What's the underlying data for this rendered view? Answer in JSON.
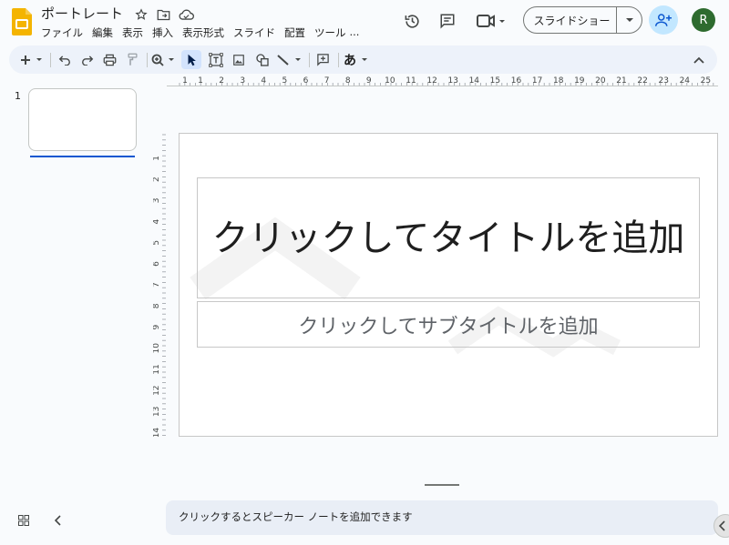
{
  "header": {
    "doc_title": "ポートレート",
    "menus": [
      "ファイル",
      "編集",
      "表示",
      "挿入",
      "表示形式",
      "スライド",
      "配置",
      "ツール",
      "..."
    ],
    "present_label": "スライドショー",
    "avatar_initial": "R"
  },
  "ruler": {
    "horizontal": [
      "1",
      "1",
      "2",
      "3",
      "4",
      "5",
      "6",
      "7",
      "8",
      "9",
      "10",
      "11",
      "12",
      "13",
      "14",
      "15",
      "16",
      "17",
      "18",
      "19",
      "20",
      "21",
      "22",
      "23",
      "24",
      "25"
    ],
    "vertical": [
      "1",
      "2",
      "3",
      "4",
      "5",
      "6",
      "7",
      "8",
      "9",
      "10",
      "11",
      "12",
      "13",
      "14"
    ]
  },
  "filmstrip": {
    "slide_number": "1"
  },
  "slide": {
    "title_placeholder": "クリックしてタイトルを追加",
    "subtitle_placeholder": "クリックしてサブタイトルを追加"
  },
  "notes": {
    "placeholder": "クリックするとスピーカー ノートを追加できます"
  },
  "colors": {
    "accent": "#0b57d0",
    "toolbar_bg": "#edf2fa",
    "share_bg": "#c2e7ff",
    "app_icon": "#f4b400"
  },
  "icons": [
    "slides-logo",
    "star-icon",
    "move-folder-icon",
    "cloud-saved-icon",
    "history-icon",
    "comment-icon",
    "meet-icon",
    "add-person-icon",
    "plus-icon",
    "undo-icon",
    "redo-icon",
    "print-icon",
    "paint-format-icon",
    "zoom-icon",
    "select-icon",
    "textbox-icon",
    "image-icon",
    "shape-icon",
    "line-icon",
    "add-comment-icon",
    "input-tools-icon",
    "collapse-icon",
    "grid-view-icon",
    "chevron-left-icon"
  ]
}
